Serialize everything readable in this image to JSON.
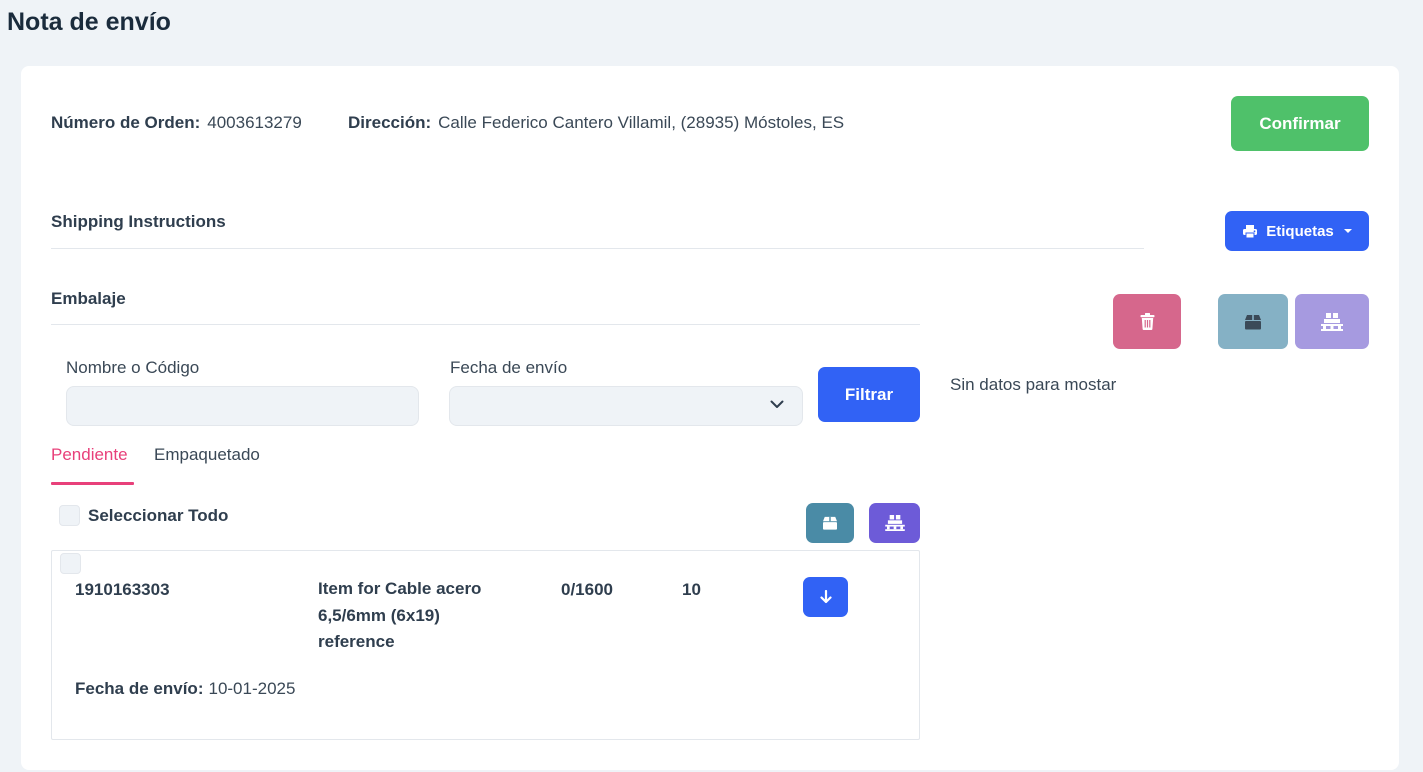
{
  "page": {
    "title": "Nota de envío"
  },
  "order": {
    "number_label": "Número de Orden:",
    "number_value": "4003613279",
    "address_label": "Dirección:",
    "address_value": "Calle Federico Cantero Villamil, (28935) Móstoles, ES",
    "confirm_label": "Confirmar"
  },
  "sections": {
    "shipping_instructions": "Shipping Instructions",
    "packaging": "Embalaje"
  },
  "labels_button": {
    "label": "Etiquetas",
    "icon": "printer-icon"
  },
  "right_panel": {
    "empty_text": "Sin datos para mostar",
    "delete_icon": "trash-icon",
    "box_icon": "box-icon",
    "pallet_icon": "pallet-icon",
    "colors": {
      "delete": "#d6678c",
      "box": "#85b1c5",
      "pallet": "#a69ae0"
    }
  },
  "filters": {
    "name_label": "Nombre o Código",
    "name_value": "",
    "date_label": "Fecha de envío",
    "date_value": "",
    "filter_button": "Filtrar"
  },
  "tabs": [
    {
      "label": "Pendiente",
      "active": true
    },
    {
      "label": "Empaquetado",
      "active": false
    }
  ],
  "select_all": {
    "label": "Seleccionar Todo",
    "checked": false
  },
  "bulk_actions": {
    "box_icon": "box-icon",
    "pallet_icon": "pallet-icon",
    "colors": {
      "box": "#4a8ba6",
      "pallet": "#6d5bd8"
    }
  },
  "items": [
    {
      "code": "1910163303",
      "description": "Item for Cable acero 6,5/6mm (6x19) reference",
      "quantity": "0/1600",
      "units": "10",
      "date_label": "Fecha de envío:",
      "date_value": "10-01-2025",
      "action_icon": "arrow-down-icon"
    }
  ],
  "colors": {
    "primary": "#3162f5",
    "success": "#4fc16a",
    "accent_tab": "#e8407a",
    "background": "#eff3f7"
  }
}
